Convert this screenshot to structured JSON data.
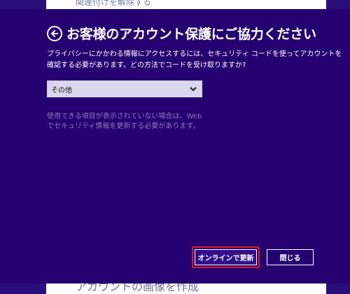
{
  "background": {
    "top_text": "関連付けを解除する",
    "bottom_text": "アカウントの画像を作成"
  },
  "dialog": {
    "title": "お客様のアカウント保護にご協力ください",
    "description_line1": "プライバシーにかかわる情報にアクセスするには、セキュリティ コードを使ってアカウントを",
    "description_line2": "確認する必要があります。どの方法でコードを受け取りますか?",
    "method_select": {
      "selected": "その他"
    },
    "note_line1": "使用できる項目が表示されていない場合は、Web",
    "note_line2": "でセキュリティ情報を更新する必要があります。",
    "buttons": {
      "update_online": "オンラインで更新",
      "close": "閉じる"
    }
  },
  "colors": {
    "dialog_background": "#250071",
    "highlight": "#e01a20"
  },
  "icons": {
    "back": "back-arrow-icon",
    "dropdown": "chevron-down-icon"
  }
}
